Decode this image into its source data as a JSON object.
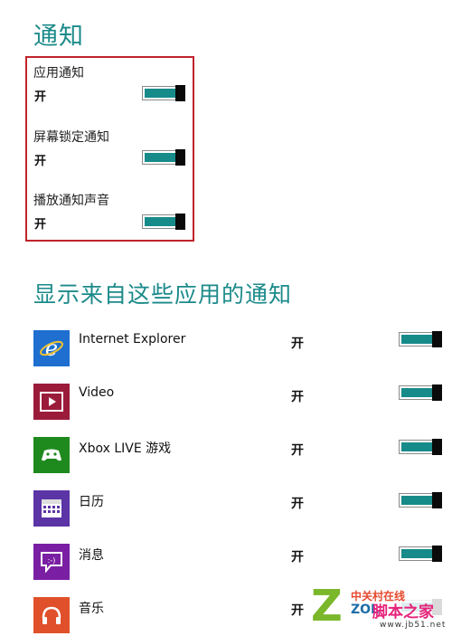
{
  "notifications": {
    "title": "通知",
    "settings": [
      {
        "label": "应用通知",
        "state": "开",
        "on": true
      },
      {
        "label": "屏幕锁定通知",
        "state": "开",
        "on": true
      },
      {
        "label": "播放通知声音",
        "state": "开",
        "on": true
      }
    ]
  },
  "apps_section": {
    "title": "显示来自这些应用的通知",
    "apps": [
      {
        "name": "Internet Explorer",
        "state": "开",
        "on": true,
        "icon": "internet-explorer-icon",
        "color": "#1e6fd0"
      },
      {
        "name": "Video",
        "state": "开",
        "on": true,
        "icon": "video-icon",
        "color": "#9b1b3a"
      },
      {
        "name": "Xbox LIVE 游戏",
        "state": "开",
        "on": true,
        "icon": "xbox-icon",
        "color": "#1e8a1e"
      },
      {
        "name": "日历",
        "state": "开",
        "on": true,
        "icon": "calendar-icon",
        "color": "#5b34a6"
      },
      {
        "name": "消息",
        "state": "开",
        "on": true,
        "icon": "messaging-icon",
        "color": "#7a1fa3"
      },
      {
        "name": "音乐",
        "state": "开",
        "on": true,
        "icon": "music-icon",
        "color": "#e0502a"
      }
    ]
  },
  "watermark": {
    "top_text": "中关村在线",
    "zol": "ZOL",
    "main": "脚本之家",
    "url": "www.jb51.net"
  },
  "colors": {
    "accent": "#1c8a8a",
    "toggle_fill": "#178a8a",
    "highlight": "#c0232c"
  }
}
